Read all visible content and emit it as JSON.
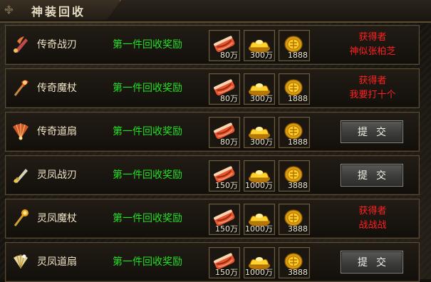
{
  "panel": {
    "title": "神装回收"
  },
  "rows": [
    {
      "name": "传奇战刃",
      "condition": "第一件回收奖励",
      "rewards": [
        {
          "icon": "meat-icon",
          "amount": "80万"
        },
        {
          "icon": "gold-ingot-icon",
          "amount": "300万"
        },
        {
          "icon": "gold-coin-icon",
          "amount": "1888"
        }
      ],
      "status": "claimed",
      "winner_label": "获得者",
      "winner_name": "神似张柏芝"
    },
    {
      "name": "传奇魔杖",
      "condition": "第一件回收奖励",
      "rewards": [
        {
          "icon": "meat-icon",
          "amount": "80万"
        },
        {
          "icon": "gold-ingot-icon",
          "amount": "300万"
        },
        {
          "icon": "gold-coin-icon",
          "amount": "1888"
        }
      ],
      "status": "claimed",
      "winner_label": "获得者",
      "winner_name": "我要打十个"
    },
    {
      "name": "传奇道扇",
      "condition": "第一件回收奖励",
      "rewards": [
        {
          "icon": "meat-icon",
          "amount": "80万"
        },
        {
          "icon": "gold-ingot-icon",
          "amount": "300万"
        },
        {
          "icon": "gold-coin-icon",
          "amount": "1888"
        }
      ],
      "status": "open",
      "button_label": "提交"
    },
    {
      "name": "灵凤战刃",
      "condition": "第一件回收奖励",
      "rewards": [
        {
          "icon": "meat-icon",
          "amount": "150万"
        },
        {
          "icon": "gold-ingot-icon",
          "amount": "1000万"
        },
        {
          "icon": "gold-coin-icon",
          "amount": "3888"
        }
      ],
      "status": "open",
      "button_label": "提交"
    },
    {
      "name": "灵凤魔杖",
      "condition": "第一件回收奖励",
      "rewards": [
        {
          "icon": "meat-icon",
          "amount": "150万"
        },
        {
          "icon": "gold-ingot-icon",
          "amount": "1000万"
        },
        {
          "icon": "gold-coin-icon",
          "amount": "3888"
        }
      ],
      "status": "claimed",
      "winner_label": "获得者",
      "winner_name": "战战战"
    },
    {
      "name": "灵凤道扇",
      "condition": "第一件回收奖励",
      "rewards": [
        {
          "icon": "meat-icon",
          "amount": "150万"
        },
        {
          "icon": "gold-ingot-icon",
          "amount": "1000万"
        },
        {
          "icon": "gold-coin-icon",
          "amount": "3888"
        }
      ],
      "status": "open",
      "button_label": "提交"
    }
  ]
}
